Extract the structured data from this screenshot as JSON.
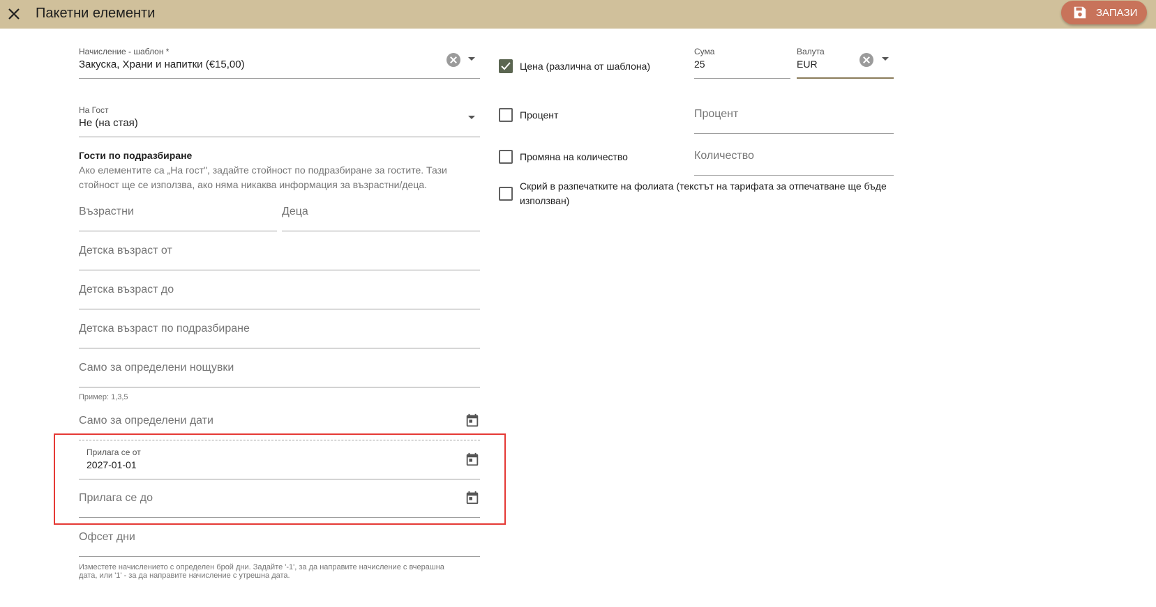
{
  "header": {
    "title": "Пакетни елементи",
    "save_label": "ЗАПАЗИ"
  },
  "left": {
    "charge_template": {
      "label": "Начисление - шаблон *",
      "value": "Закуска, Храни и напитки (€15,00)"
    },
    "per_guest": {
      "label": "На Гост",
      "value": "Не (на стая)"
    },
    "default_guests": {
      "title": "Гости по подразбиране",
      "description_line1": "Ако елементите са „На гост\", задайте стойност по подразбиране за гостите. Тази",
      "description_line2": "стойност ще се използва, ако няма никаква информация за възрастни/деца."
    },
    "adults": {
      "placeholder": "Възрастни"
    },
    "children": {
      "placeholder": "Деца"
    },
    "child_age_from": {
      "placeholder": "Детска възраст от"
    },
    "child_age_to": {
      "placeholder": "Детска възраст до"
    },
    "child_age_default": {
      "placeholder": "Детска възраст по подразбиране"
    },
    "specific_nights": {
      "placeholder": "Само за определени нощувки",
      "hint": "Пример: 1,3,5"
    },
    "specific_dates": {
      "placeholder": "Само за определени дати"
    },
    "applies_from": {
      "label": "Прилага се от",
      "value": "2027-01-01"
    },
    "applies_to": {
      "placeholder": "Прилага се до"
    },
    "offset_days": {
      "placeholder": "Офсет дни",
      "hint_line1": "Изместете начислението с определен брой дни. Задайте '-1', за да направите начисление с вчерашна",
      "hint_line2": "дата, или '1' - за да направите начисление с утрешна дата."
    }
  },
  "right": {
    "price_override": {
      "label": "Цена (различна от шаблона)",
      "checked": true
    },
    "amount": {
      "label": "Сума",
      "value": "25"
    },
    "currency": {
      "label": "Валута",
      "value": "EUR"
    },
    "percent": {
      "label": "Процент",
      "checked": false,
      "placeholder": "Процент"
    },
    "quantity_change": {
      "label": "Промяна на количество",
      "checked": false,
      "placeholder": "Количество"
    },
    "hide_in_folio": {
      "label_line1": "Скрий в разпечатките на фолиата (текстът на тарифата за отпечатване ще бъде",
      "label_line2": "използван)",
      "checked": false
    }
  },
  "colors": {
    "header_bg": "#d0c09b",
    "save_button": "#c8735a",
    "checkbox_checked": "#5b6651",
    "highlight_border": "#e53935"
  },
  "icons": [
    "close-icon",
    "save-icon",
    "clear-icon",
    "chevron-down-icon",
    "calendar-icon",
    "check-icon"
  ]
}
